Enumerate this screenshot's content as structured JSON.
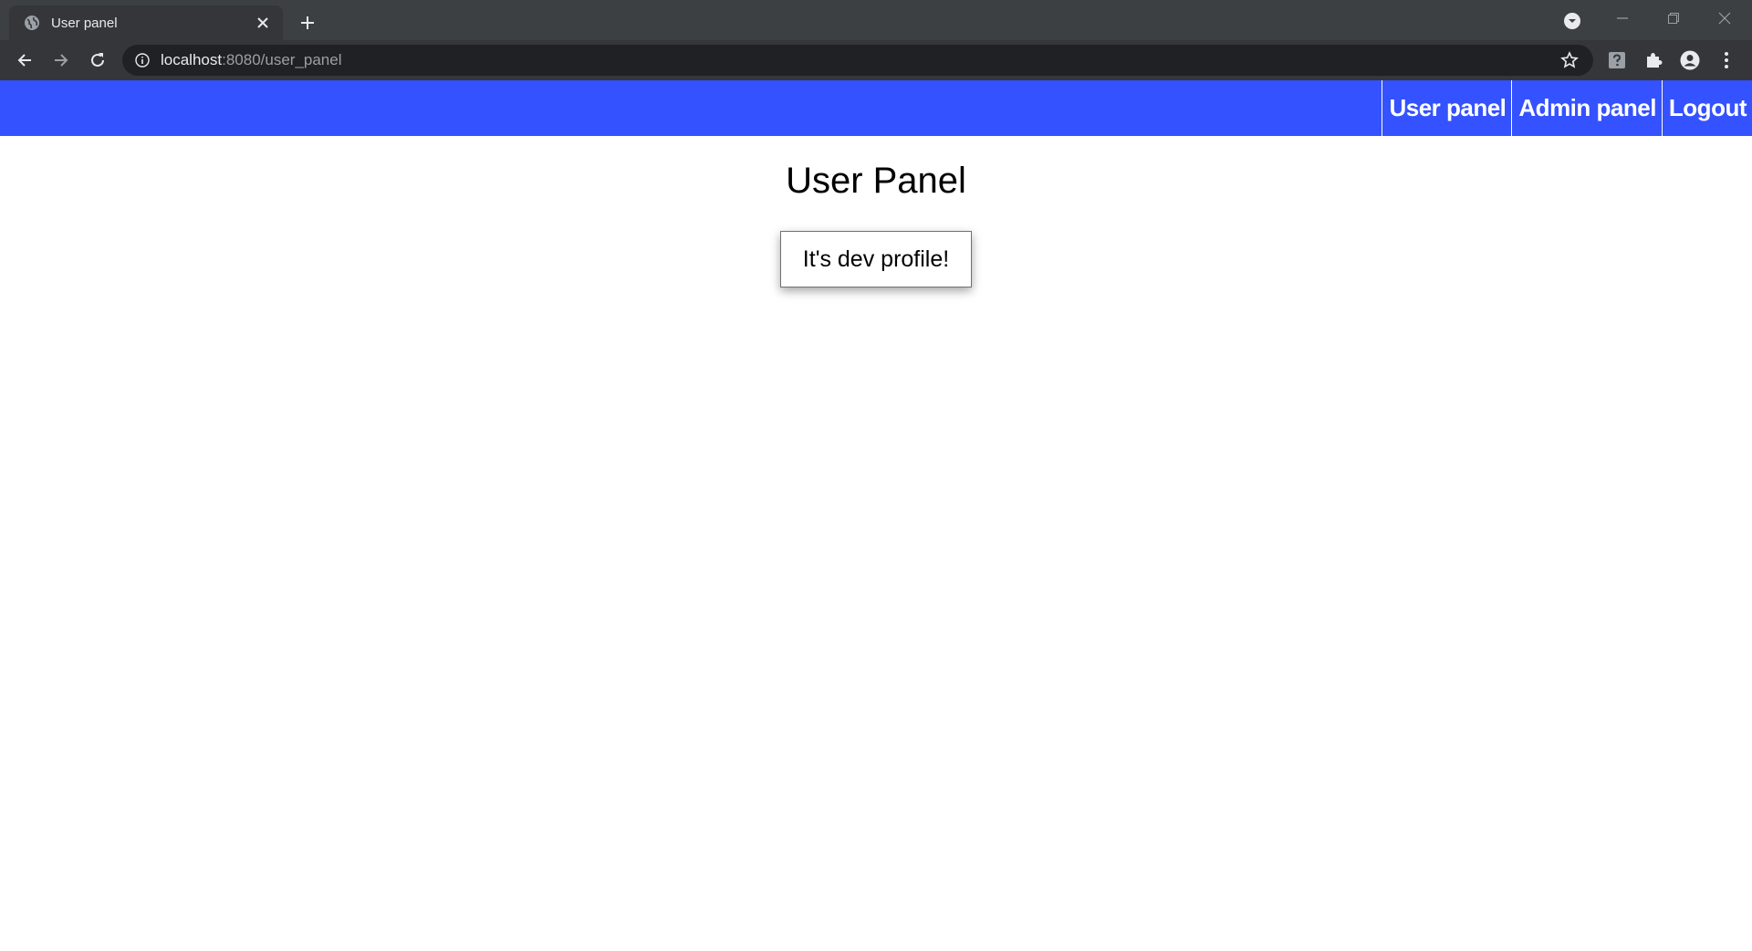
{
  "browser": {
    "tab_title": "User panel",
    "url_host": "localhost",
    "url_rest": ":8080/user_panel",
    "icons": {
      "favicon": "globe-icon",
      "tab_close": "close-icon",
      "new_tab": "plus-icon",
      "tab_search": "chevron-down-icon",
      "minimize": "minimize-icon",
      "restore": "restore-icon",
      "close": "close-icon",
      "back": "arrow-left-icon",
      "forward": "arrow-right-icon",
      "reload": "reload-icon",
      "site_info": "info-icon",
      "bookmark": "star-icon",
      "help_ext": "help-icon",
      "extensions": "puzzle-icon",
      "profile": "person-icon",
      "menu": "kebab-menu-icon"
    },
    "colors": {
      "tabstrip": "#3c4043",
      "toolbar": "#35363a",
      "omnibox": "#202124"
    }
  },
  "navbar": {
    "links": [
      {
        "label": "User panel"
      },
      {
        "label": "Admin panel"
      },
      {
        "label": "Logout"
      }
    ],
    "color": "#3452ff"
  },
  "main": {
    "title": "User Panel",
    "profile_message": "It's dev profile!"
  }
}
